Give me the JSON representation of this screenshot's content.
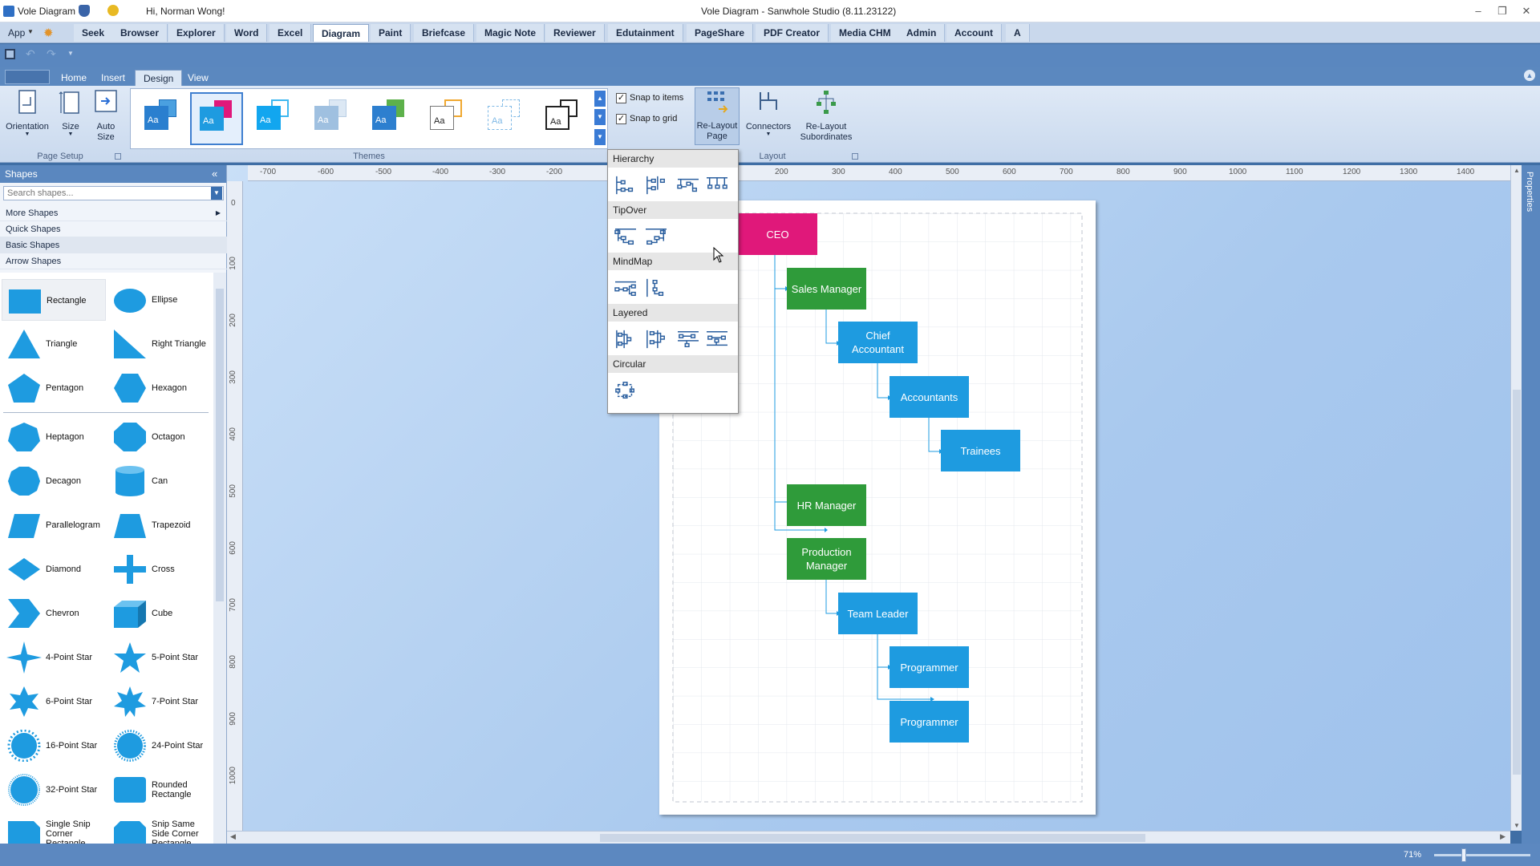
{
  "app": {
    "name": "Vole Diagram",
    "greeting": "Hi, Norman Wong!",
    "window_title": "Vole Diagram - Sanwhole Studio (8.11.23122)"
  },
  "module_tabs": [
    "App",
    "Seek",
    "Browser",
    "Explorer",
    "Word",
    "Excel",
    "Diagram",
    "Paint",
    "Briefcase",
    "Magic Note",
    "Reviewer",
    "Edutainment",
    "PageShare",
    "PDF Creator",
    "Media CHM",
    "Admin",
    "Account",
    "A"
  ],
  "ribbon_tabs": [
    "Home",
    "Insert",
    "Design",
    "View"
  ],
  "page_setup": {
    "orientation": "Orientation",
    "size": "Size",
    "auto_size": "Auto Size",
    "label": "Page Setup"
  },
  "themes": {
    "label": "Themes",
    "sample_text": "Aa"
  },
  "snap": {
    "items": "Snap to items",
    "grid": "Snap to grid"
  },
  "layout": {
    "relayout_page": "Re-Layout Page",
    "connectors": "Connectors",
    "relayout_subordinates": "Re-Layout Subordinates",
    "label": "Layout"
  },
  "layout_menu": {
    "sections": [
      "Hierarchy",
      "TipOver",
      "MindMap",
      "Layered",
      "Circular"
    ]
  },
  "shapes_panel": {
    "title": "Shapes",
    "search_placeholder": "Search shapes...",
    "categories": [
      "More Shapes",
      "Quick Shapes",
      "Basic Shapes",
      "Arrow Shapes"
    ],
    "items": [
      "Rectangle",
      "Ellipse",
      "Triangle",
      "Right Triangle",
      "Pentagon",
      "Hexagon",
      "Heptagon",
      "Octagon",
      "Decagon",
      "Can",
      "Parallelogram",
      "Trapezoid",
      "Diamond",
      "Cross",
      "Chevron",
      "Cube",
      "4-Point Star",
      "5-Point Star",
      "6-Point Star",
      "7-Point Star",
      "16-Point Star",
      "24-Point Star",
      "32-Point Star",
      "Rounded Rectangle",
      "Single Snip Corner Rectangle",
      "Snip Same Side Corner Rectangle"
    ]
  },
  "rulers": {
    "h": [
      "-700",
      "-600",
      "-500",
      "-400",
      "-300",
      "-200",
      "200",
      "300",
      "400",
      "500",
      "600",
      "700",
      "800",
      "900",
      "1000",
      "1100",
      "1200",
      "1300",
      "1400"
    ],
    "v": [
      "0",
      "100",
      "200",
      "300",
      "400",
      "500",
      "600",
      "700",
      "800",
      "900",
      "1000"
    ]
  },
  "diagram": {
    "nodes": [
      "CEO",
      "Sales Manager",
      "Chief Accountant",
      "Accountants",
      "Trainees",
      "HR Manager",
      "Production Manager",
      "Team Leader",
      "Programmer",
      "Programmer"
    ],
    "colors": {
      "ceo": "#e0187a",
      "manager": "#2f9b3a",
      "staff": "#1e9be0"
    }
  },
  "right_panel": {
    "label": "Properties"
  },
  "status": {
    "zoom": "71%"
  }
}
